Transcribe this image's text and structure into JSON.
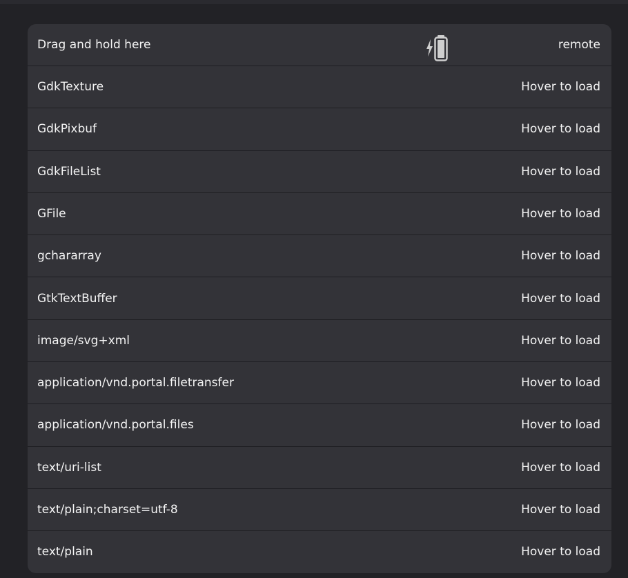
{
  "header": {
    "drag_label": "Drag and hold here",
    "location_label": "remote",
    "status_icon": "battery-charging-icon"
  },
  "formats": [
    {
      "name": "GdkTexture",
      "status": "Hover to load"
    },
    {
      "name": "GdkPixbuf",
      "status": "Hover to load"
    },
    {
      "name": "GdkFileList",
      "status": "Hover to load"
    },
    {
      "name": "GFile",
      "status": "Hover to load"
    },
    {
      "name": "gchararray",
      "status": "Hover to load"
    },
    {
      "name": "GtkTextBuffer",
      "status": "Hover to load"
    },
    {
      "name": "image/svg+xml",
      "status": "Hover to load"
    },
    {
      "name": "application/vnd.portal.filetransfer",
      "status": "Hover to load"
    },
    {
      "name": "application/vnd.portal.files",
      "status": "Hover to load"
    },
    {
      "name": "text/uri-list",
      "status": "Hover to load"
    },
    {
      "name": "text/plain;charset=utf-8",
      "status": "Hover to load"
    },
    {
      "name": "text/plain",
      "status": "Hover to load"
    }
  ],
  "colors": {
    "background": "#222226",
    "card": "#333338",
    "text": "#f4f4f4"
  }
}
